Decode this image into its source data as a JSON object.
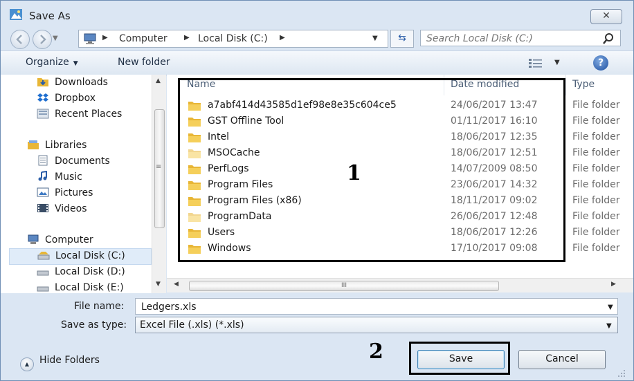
{
  "window": {
    "title": "Save As",
    "close_glyph": "✕"
  },
  "address": {
    "crumbs": [
      "Computer",
      "Local Disk (C:)"
    ],
    "search_placeholder": "Search Local Disk (C:)"
  },
  "toolbar": {
    "organize": "Organize",
    "new_folder": "New folder",
    "help": "?"
  },
  "nav": {
    "items": [
      {
        "label": "Downloads",
        "icon": "downloads-folder-icon"
      },
      {
        "label": "Dropbox",
        "icon": "dropbox-icon"
      },
      {
        "label": "Recent Places",
        "icon": "recent-places-icon"
      },
      {
        "label": "Libraries",
        "icon": "libraries-icon"
      },
      {
        "label": "Documents",
        "icon": "documents-icon"
      },
      {
        "label": "Music",
        "icon": "music-icon"
      },
      {
        "label": "Pictures",
        "icon": "pictures-icon"
      },
      {
        "label": "Videos",
        "icon": "videos-icon"
      },
      {
        "label": "Computer",
        "icon": "computer-icon"
      },
      {
        "label": "Local Disk (C:)",
        "icon": "drive-icon",
        "selected": true
      },
      {
        "label": "Local Disk (D:)",
        "icon": "drive-icon"
      },
      {
        "label": "Local Disk (E:)",
        "icon": "drive-icon"
      }
    ]
  },
  "files": {
    "columns": {
      "name": "Name",
      "date": "Date modified",
      "type": "Type"
    },
    "rows": [
      {
        "name": "a7abf414d43585d1ef98e8e35c604ce5",
        "date": "24/06/2017 13:47",
        "type": "File folder"
      },
      {
        "name": "GST Offline Tool",
        "date": "01/11/2017 16:10",
        "type": "File folder"
      },
      {
        "name": "Intel",
        "date": "18/06/2017 12:35",
        "type": "File folder"
      },
      {
        "name": "MSOCache",
        "date": "18/06/2017 12:51",
        "type": "File folder"
      },
      {
        "name": "PerfLogs",
        "date": "14/07/2009 08:50",
        "type": "File folder"
      },
      {
        "name": "Program Files",
        "date": "23/06/2017 14:32",
        "type": "File folder"
      },
      {
        "name": "Program Files (x86)",
        "date": "18/11/2017 09:02",
        "type": "File folder"
      },
      {
        "name": "ProgramData",
        "date": "26/06/2017 12:48",
        "type": "File folder"
      },
      {
        "name": "Users",
        "date": "18/06/2017 12:26",
        "type": "File folder"
      },
      {
        "name": "Windows",
        "date": "17/10/2017 09:08",
        "type": "File folder"
      }
    ]
  },
  "hscroll": {
    "grip": "III"
  },
  "form": {
    "file_name_label": "File name:",
    "file_name_value": "Ledgers.xls",
    "type_label": "Save as type:",
    "type_value": "Excel File (.xls) (*.xls)"
  },
  "footer": {
    "hide_folders": "Hide Folders",
    "save": "Save",
    "cancel": "Cancel"
  },
  "annotations": {
    "one": "1",
    "two": "2"
  },
  "colors": {
    "accent": "#2a5da8",
    "folder": "#e8b636",
    "window_bg": "#dbe6f3",
    "selection": "#e0ecf9"
  }
}
